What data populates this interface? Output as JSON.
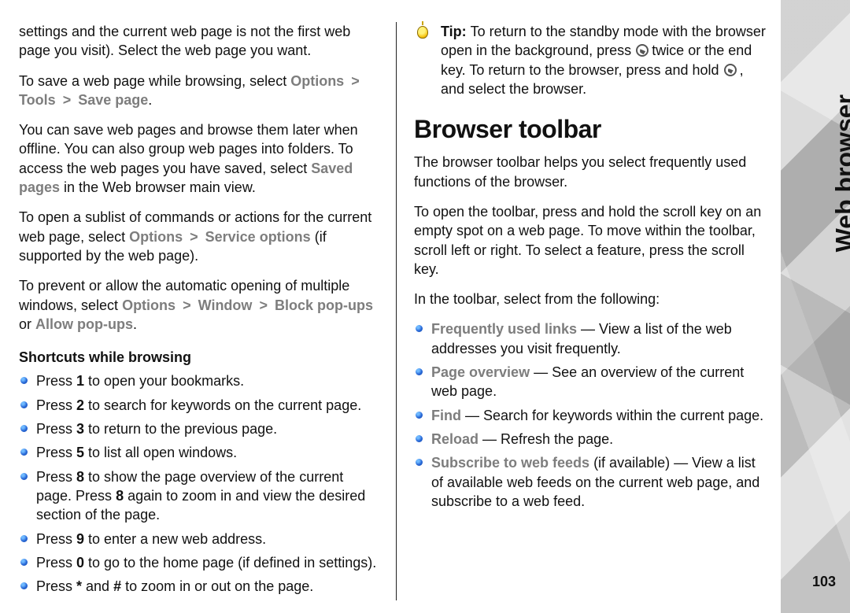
{
  "side": {
    "section": "Web browser",
    "page": "103"
  },
  "left": {
    "p1a": "settings and the current web page is not the first web page you visit). Select the web page you want.",
    "p2_lead": "To save a web page while browsing, select ",
    "opt_options": "Options",
    "opt_tools": "Tools",
    "opt_save_page": "Save page",
    "p3a": "You can save web pages and browse them later when offline. You can also group web pages into folders. To access the web pages you have saved, select ",
    "opt_saved_pages": "Saved pages",
    "p3b": " in the Web browser main view.",
    "p4a": "To open a sublist of commands or actions for the current web page, select ",
    "opt_service_options": "Service options",
    "p4b": " (if supported by the web page).",
    "p5a": "To prevent or allow the automatic opening of multiple windows, select ",
    "opt_window": "Window",
    "opt_block": "Block pop-ups",
    "p5_or": " or ",
    "opt_allow": "Allow pop-ups",
    "h3": "Shortcuts while browsing",
    "li1a": "Press ",
    "li1k": "1",
    "li1b": " to open your bookmarks.",
    "li2a": "Press ",
    "li2k": "2",
    "li2b": " to search for keywords on the current page.",
    "li3a": "Press ",
    "li3k": "3",
    "li3b": " to return to the previous page.",
    "li4a": "Press ",
    "li4k": "5",
    "li4b": " to list all open windows.",
    "li5a": "Press ",
    "li5k": "8",
    "li5b": " to show the page overview of the current page. Press ",
    "li5k2": "8",
    "li5c": " again to zoom in and view the desired section of the page.",
    "li6a": "Press ",
    "li6k": "9",
    "li6b": " to enter a new web address.",
    "li7a": "Press ",
    "li7k": "0",
    "li7b": " to go to the home page (if defined in settings).",
    "li8a": "Press ",
    "li8k1": "*",
    "li8mid": " and ",
    "li8k2": "#",
    "li8b": " to zoom in or out on the page."
  },
  "right": {
    "tip_label": "Tip: ",
    "tip_a": " To return to the standby mode with the browser open in the background, press ",
    "tip_b": " twice or the end key. To return to the browser, press and hold ",
    "tip_c": " , and select the browser.",
    "h2": "Browser toolbar",
    "p1": "The browser toolbar helps you select frequently used functions of the browser.",
    "p2": "To open the toolbar, press and hold the scroll key on an empty spot on a web page. To move within the toolbar, scroll left or right. To select a feature, press the scroll key.",
    "p3": "In the toolbar, select from the following:",
    "li1_t": "Frequently used links",
    "li1_r": "  — View a list of the web addresses you visit frequently.",
    "li2_t": "Page overview",
    "li2_r": "  — See an overview of the current web page.",
    "li3_t": "Find",
    "li3_r": " — Search for keywords within the current page.",
    "li4_t": "Reload",
    "li4_r": " — Refresh the page.",
    "li5_t": "Subscribe to web feeds",
    "li5_r": " (if available) — View a list of available web feeds on the current web page, and subscribe to a web feed."
  }
}
